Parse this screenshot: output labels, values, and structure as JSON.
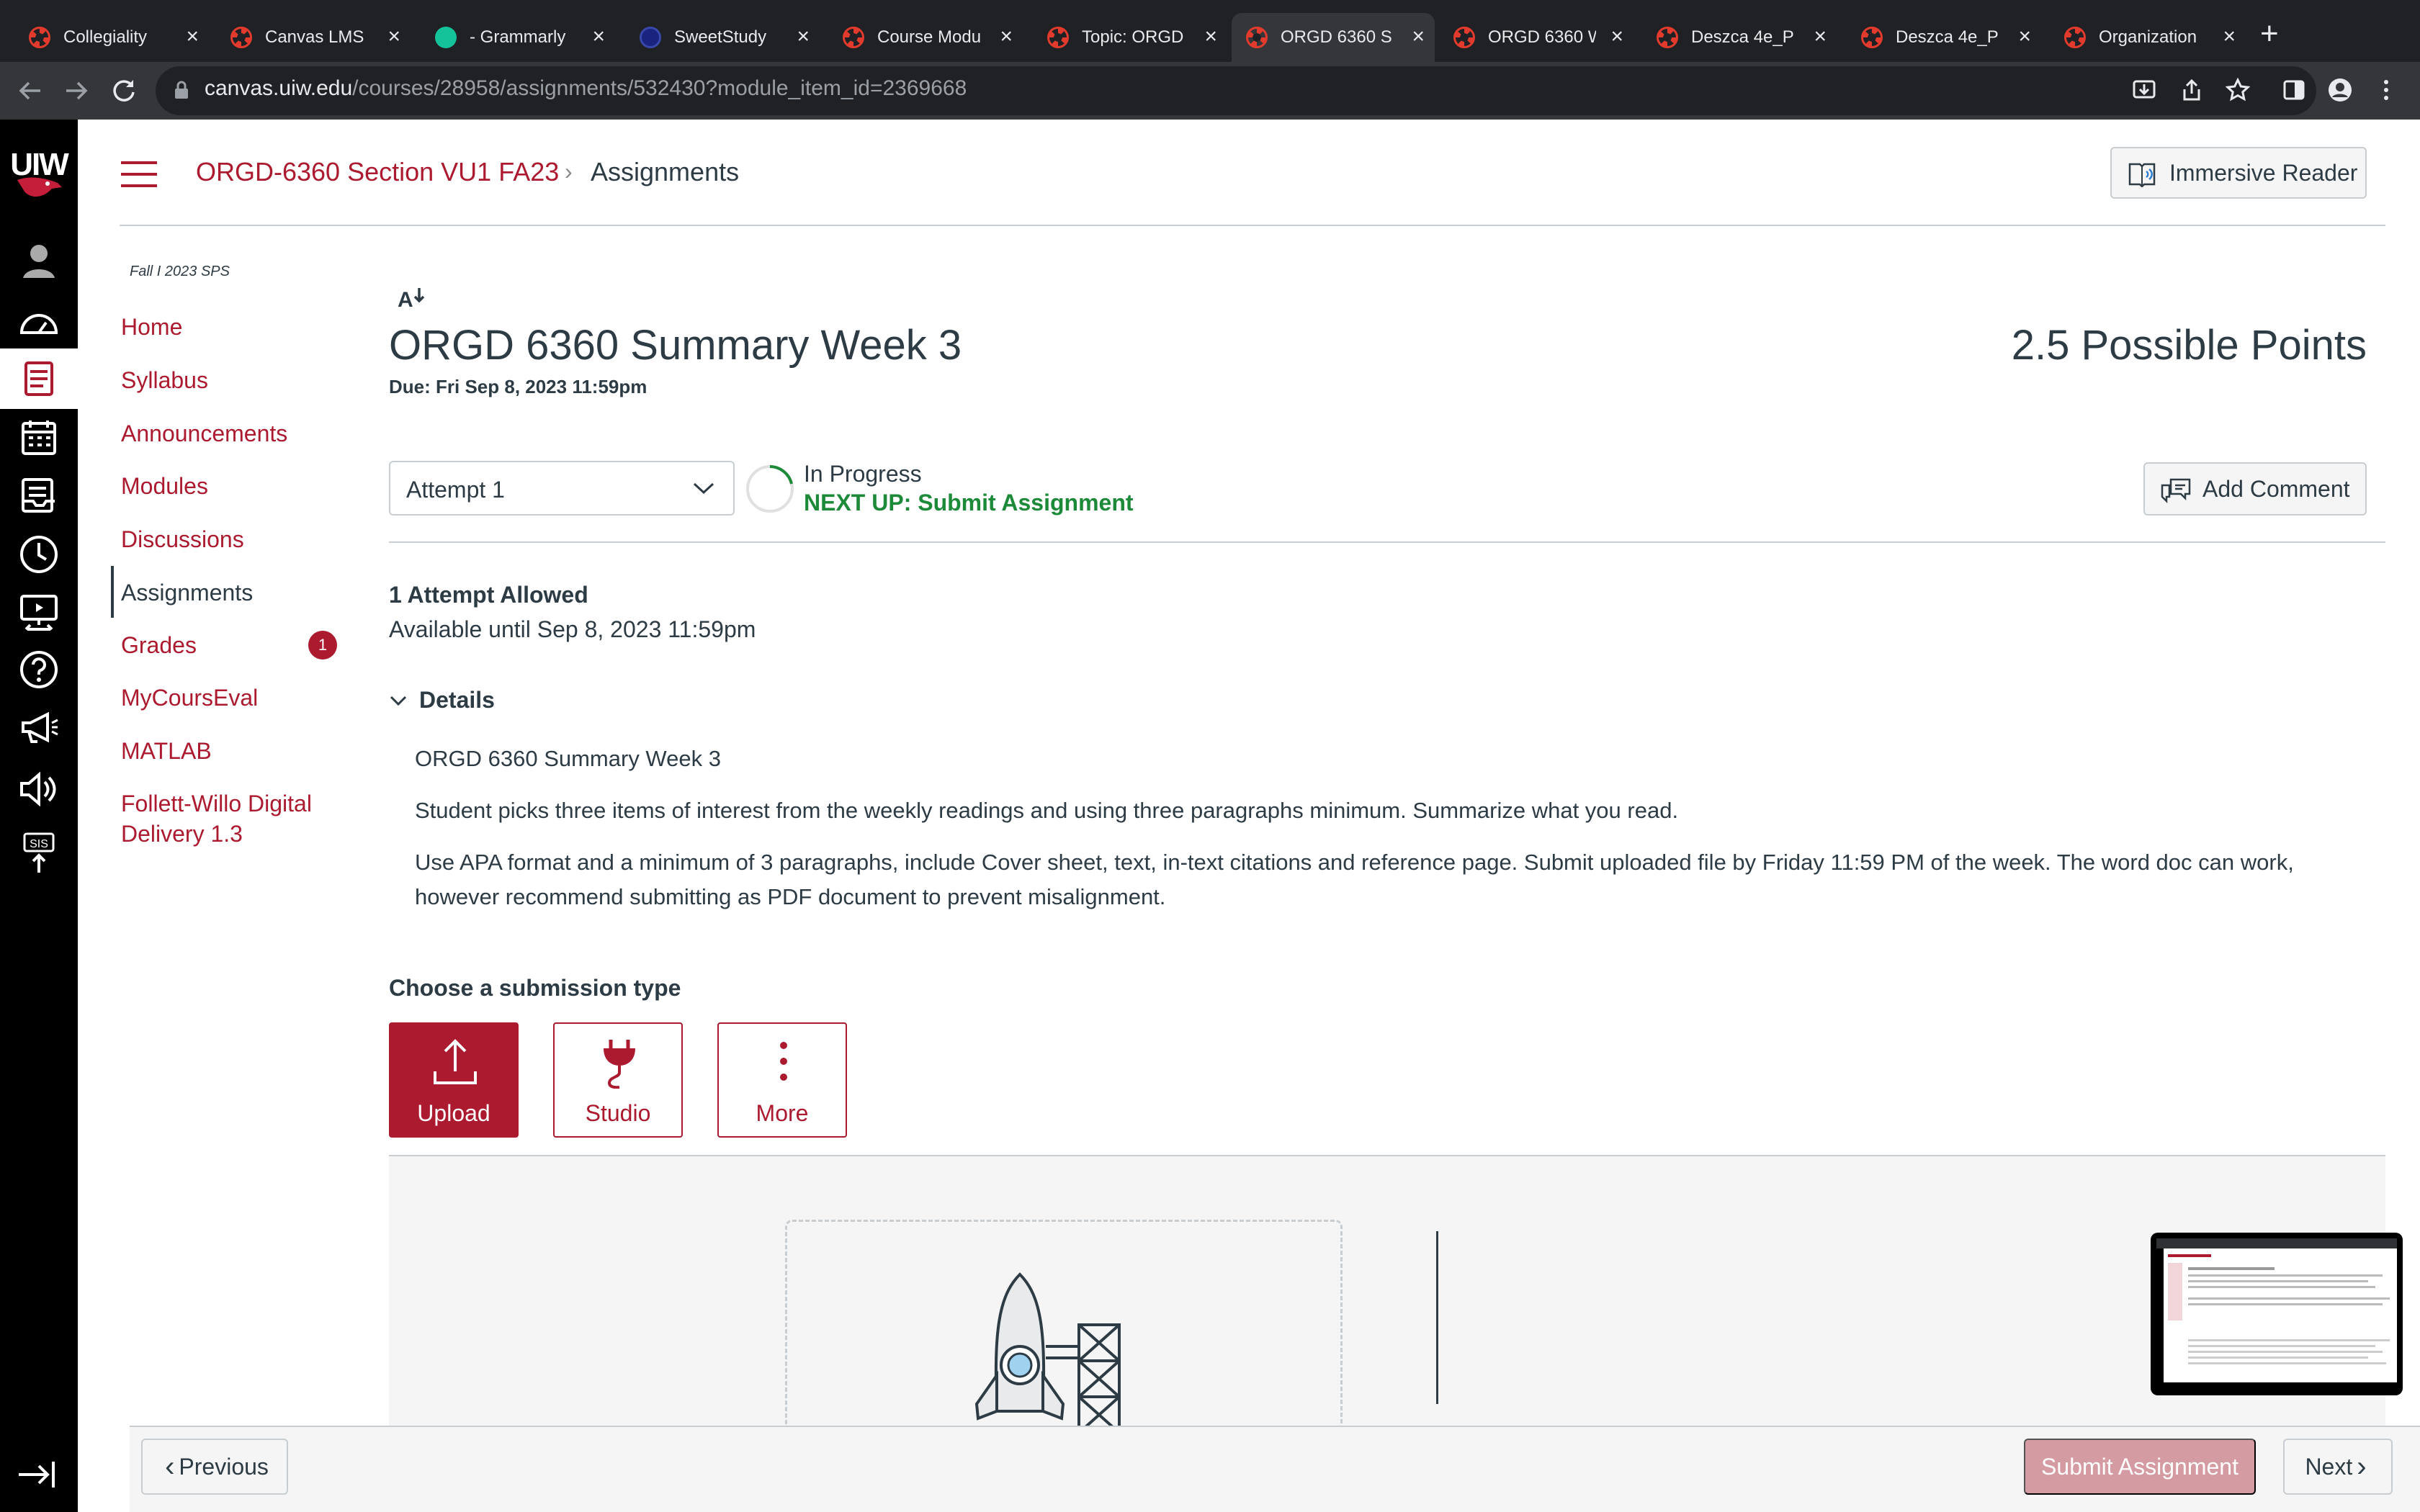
{
  "browser": {
    "tabs": [
      {
        "label": "Collegiality",
        "favicon": "canvas-icon",
        "active": false
      },
      {
        "label": "Canvas LMS",
        "favicon": "canvas-icon",
        "active": false
      },
      {
        "label": "- Grammarly",
        "favicon": "grammarly-icon",
        "active": false
      },
      {
        "label": "SweetStudy",
        "favicon": "sweetstudy-icon",
        "active": false
      },
      {
        "label": "Course Modu",
        "favicon": "canvas-icon",
        "active": false
      },
      {
        "label": "Topic: ORGD",
        "favicon": "canvas-icon",
        "active": false
      },
      {
        "label": "ORGD 6360 S",
        "favicon": "canvas-icon",
        "active": true
      },
      {
        "label": "ORGD 6360 W",
        "favicon": "canvas-icon",
        "active": false
      },
      {
        "label": "Deszca 4e_P",
        "favicon": "canvas-icon",
        "active": false
      },
      {
        "label": "Deszca 4e_P",
        "favicon": "canvas-icon",
        "active": false
      },
      {
        "label": "Organization",
        "favicon": "canvas-icon",
        "active": false
      }
    ],
    "url_host": "canvas.uiw.edu",
    "url_path": "/courses/28958/assignments/532430?module_item_id=2369668",
    "new_tab_symbol": "+",
    "close_symbol": "×"
  },
  "global_nav": {
    "logo": "UIW",
    "items": [
      "account-icon",
      "dashboard-icon",
      "courses-icon",
      "calendar-icon",
      "inbox-icon",
      "history-icon",
      "studio-icon",
      "help-icon",
      "announcements-icon",
      "media-icon",
      "sis-icon"
    ]
  },
  "header": {
    "course_crumb": "ORGD-6360 Section VU1 FA23",
    "crumb_separator": "›",
    "current_crumb": "Assignments",
    "immersive_reader_label": "Immersive Reader"
  },
  "course_nav": {
    "term": "Fall I 2023 SPS",
    "items": [
      {
        "label": "Home"
      },
      {
        "label": "Syllabus"
      },
      {
        "label": "Announcements"
      },
      {
        "label": "Modules"
      },
      {
        "label": "Discussions"
      },
      {
        "label": "Assignments",
        "active": true
      },
      {
        "label": "Grades",
        "badge": "1"
      },
      {
        "label": "MyCoursEval"
      },
      {
        "label": "MATLAB"
      },
      {
        "label": "Follett-Willo Digital",
        "label2": "Delivery 1.3"
      }
    ]
  },
  "assignment": {
    "title": "ORGD 6360 Summary Week 3",
    "due": "Due: Fri Sep 8, 2023 11:59pm",
    "points": "2.5 Possible Points",
    "attempt_selected": "Attempt 1",
    "status": "In Progress",
    "next_up": "NEXT UP: Submit Assignment",
    "add_comment_label": "Add Comment",
    "attempts_allowed": "1 Attempt Allowed",
    "available_until": "Available until Sep 8, 2023 11:59pm",
    "details_label": "Details",
    "details_paragraphs": [
      "ORGD 6360 Summary Week 3",
      "Student picks three items of interest from the weekly readings and using three paragraphs minimum. Summarize what you read.",
      "Use APA format and a minimum of 3 paragraphs, include Cover sheet, text, in-text citations and reference page. Submit uploaded file by Friday 11:59 PM of the week. The word doc can work,",
      "however recommend submitting as PDF document to prevent misalignment."
    ],
    "submission_type_label": "Choose a submission type",
    "submission_types": [
      {
        "label": "Upload",
        "icon": "upload-icon",
        "selected": true
      },
      {
        "label": "Studio",
        "icon": "plug-icon",
        "selected": false
      },
      {
        "label": "More",
        "icon": "more-vertical-icon",
        "selected": false
      }
    ]
  },
  "footer": {
    "previous_label": "Previous",
    "submit_label": "Submit Assignment",
    "next_label": "Next",
    "prev_chevron": "‹",
    "next_chevron": "›"
  },
  "colors": {
    "brand": "#ac1a2f",
    "status_green": "#1d8a3a",
    "submit_disabled": "#d59ba3"
  }
}
